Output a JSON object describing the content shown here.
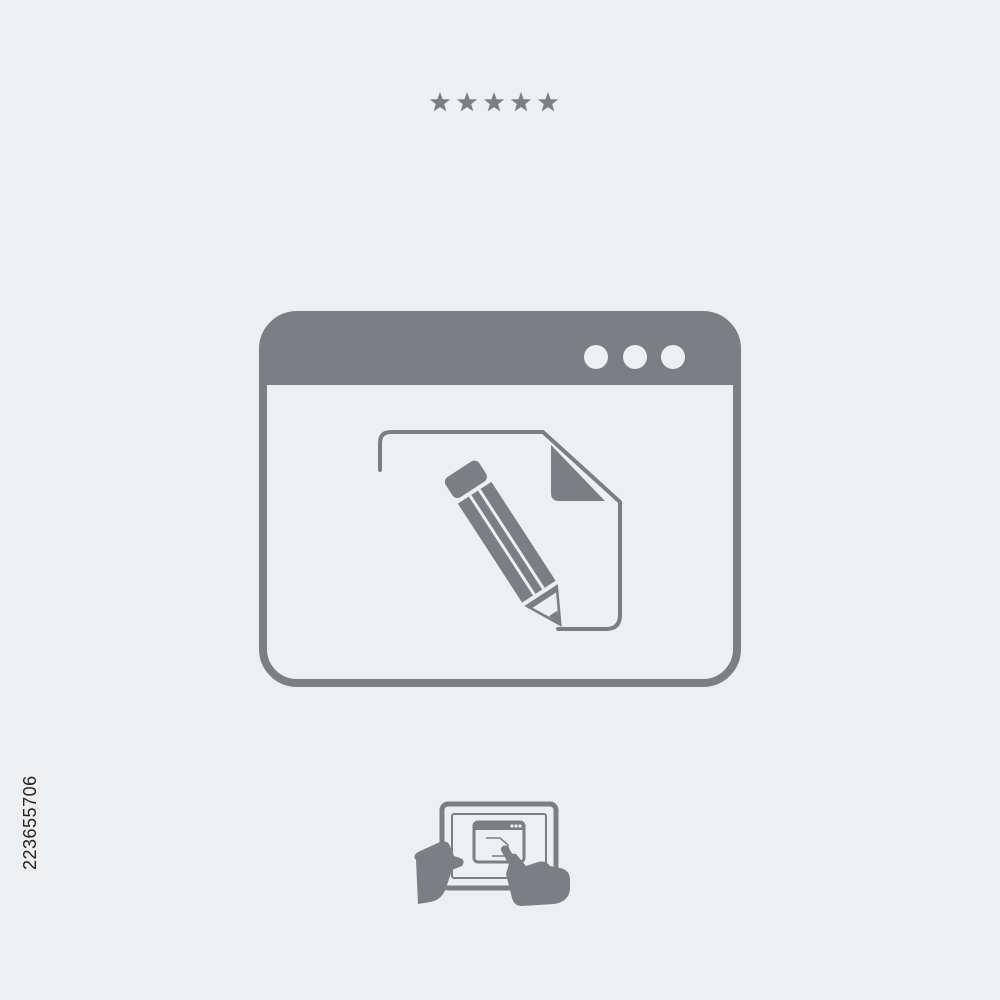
{
  "rating": {
    "stars": 5,
    "max": 5,
    "color": "#7b7f84"
  },
  "stock_id": "223655706",
  "icons": {
    "main": "browser-window-edit-document-icon",
    "secondary": "tablet-touch-icon"
  },
  "colors": {
    "background": "#eeeff1",
    "icon": "#7b7f84"
  }
}
